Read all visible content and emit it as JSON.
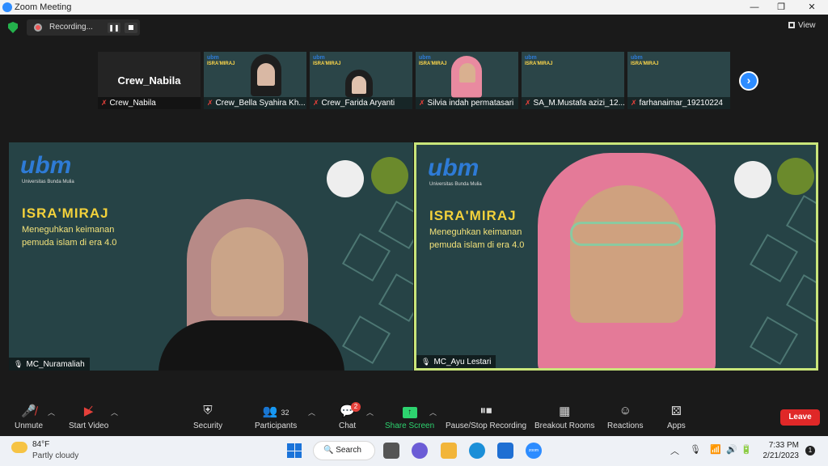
{
  "window": {
    "title": "Zoom Meeting",
    "minimize": "—",
    "maximize": "❐",
    "close": "✕"
  },
  "recording": {
    "label": "Recording...",
    "pause": "❚❚"
  },
  "view": {
    "label": "View"
  },
  "thumbnails": [
    {
      "display_name": "Crew_Nabila",
      "name": "Crew_Nabila"
    },
    {
      "name": "Crew_Bella Syahira Kh..."
    },
    {
      "name": "Crew_Farida Aryanti"
    },
    {
      "name": "Silvia indah permatasari"
    },
    {
      "name": "SA_M.Mustafa azizi_12..."
    },
    {
      "name": "farhanaimar_19210224"
    }
  ],
  "thumb_slide": {
    "title": "ISRA'MIRAJ",
    "sub": "Meneguhkan keimanan pemuda islam di era 4.0"
  },
  "slide": {
    "logo": "ubm",
    "logo_sub": "Universitas Bunda Mulia",
    "title": "ISRA'MIRAJ",
    "line1": "Meneguhkan keimanan",
    "line2": "pemuda islam di era 4.0"
  },
  "tiles": [
    {
      "name": "MC_Nuramaliah"
    },
    {
      "name": "MC_Ayu Lestari"
    }
  ],
  "toolbar": {
    "unmute": "Unmute",
    "start_video": "Start Video",
    "security": "Security",
    "participants": "Participants",
    "participants_count": "32",
    "chat": "Chat",
    "chat_badge": "2",
    "share_screen": "Share Screen",
    "pause_stop": "Pause/Stop Recording",
    "breakout": "Breakout Rooms",
    "reactions": "Reactions",
    "apps": "Apps",
    "leave": "Leave"
  },
  "taskbar": {
    "temp": "84°F",
    "condition": "Partly cloudy",
    "search": "Search",
    "zoom_label": "zoom",
    "time": "7:33 PM",
    "date": "2/21/2023",
    "notifications": "1"
  },
  "colors": {
    "slide_bg": "#264346",
    "active_border": "#c9e57a",
    "leave": "#e02828",
    "share": "#2dd36f"
  }
}
